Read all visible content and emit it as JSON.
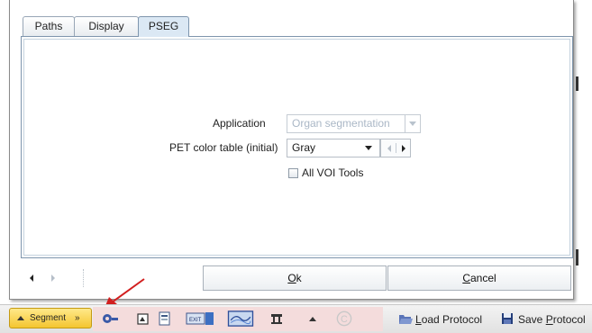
{
  "tabs": [
    {
      "label": "Paths",
      "active": false
    },
    {
      "label": "Display",
      "active": false
    },
    {
      "label": "PSEG",
      "active": true
    }
  ],
  "form": {
    "application_label": "Application",
    "application_value": "Organ segmentation",
    "pet_color_label": "PET color table (initial)",
    "pet_color_value": "Gray",
    "all_voi_tools_label": "All VOI Tools",
    "all_voi_tools_checked": false
  },
  "buttons": {
    "ok_prefix": "",
    "ok_mnemonic": "O",
    "ok_rest": "k",
    "cancel_mnemonic": "C",
    "cancel_rest": "ancel"
  },
  "toolbar": {
    "segment_label": "Segment",
    "load_mnemonic": "L",
    "load_rest": "oad Protocol",
    "save_prefix": "Save ",
    "save_mnemonic": "P",
    "save_rest": "rotocol"
  },
  "colors": {
    "tab_active_bg": "#dbe8f4",
    "segment_button": "#f4c530",
    "toolbar_highlight": "#f4dcdc",
    "annotation_arrow": "#d21f1f"
  }
}
